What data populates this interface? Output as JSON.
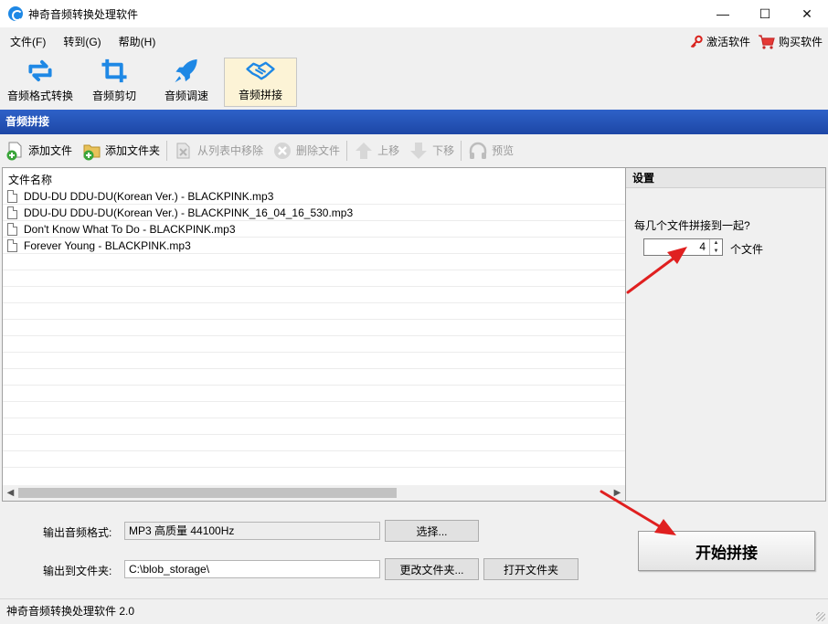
{
  "window": {
    "title": "神奇音频转换处理软件",
    "controls": {
      "minimize": "—",
      "maximize": "☐",
      "close": "✕"
    }
  },
  "menu": {
    "items": [
      "文件(F)",
      "转到(G)",
      "帮助(H)"
    ],
    "activate_label": "激活软件",
    "buy_label": "购买软件"
  },
  "toolbar": {
    "items": [
      {
        "label": "音频格式转换",
        "icon": "convert-icon"
      },
      {
        "label": "音频剪切",
        "icon": "crop-icon"
      },
      {
        "label": "音频调速",
        "icon": "rocket-icon"
      },
      {
        "label": "音频拼接",
        "icon": "handshake-icon",
        "active": true
      }
    ]
  },
  "section": {
    "title": "音频拼接"
  },
  "actions": {
    "add_file": "添加文件",
    "add_folder": "添加文件夹",
    "remove_from_list": "从列表中移除",
    "delete_file": "删除文件",
    "move_up": "上移",
    "move_down": "下移",
    "preview": "预览"
  },
  "file_list": {
    "header": "文件名称",
    "files": [
      "DDU-DU DDU-DU(Korean Ver.) - BLACKPINK.mp3",
      "DDU-DU DDU-DU(Korean Ver.) - BLACKPINK_16_04_16_530.mp3",
      "Don't Know What To Do - BLACKPINK.mp3",
      "Forever Young - BLACKPINK.mp3"
    ]
  },
  "settings": {
    "title": "设置",
    "question": "每几个文件拼接到一起?",
    "count_value": "4",
    "unit": "个文件"
  },
  "output": {
    "format_label": "输出音频格式:",
    "format_value": "MP3 高质量 44100Hz",
    "choose_button": "选择...",
    "folder_label": "输出到文件夹:",
    "folder_value": "C:\\blob_storage\\",
    "change_folder_button": "更改文件夹...",
    "open_folder_button": "打开文件夹"
  },
  "start_button": "开始拼接",
  "status": {
    "text": "神奇音频转换处理软件 2.0"
  },
  "colors": {
    "section_header": "#2e62c8",
    "active_tool_bg": "#fcf3d6",
    "annotation_arrow": "#e02020",
    "icon_blue": "#1e88e5",
    "icon_green": "#3aa53a"
  }
}
